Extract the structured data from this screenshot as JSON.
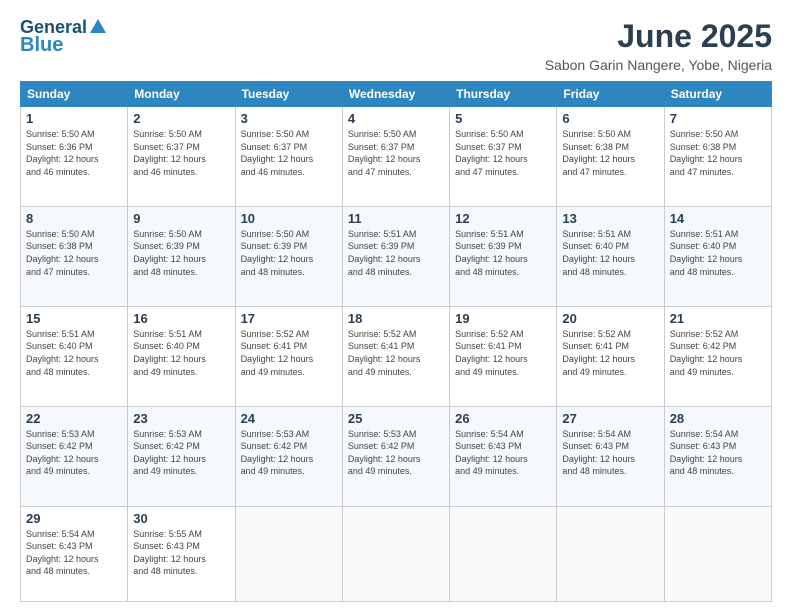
{
  "header": {
    "logo_line1": "General",
    "logo_line2": "Blue",
    "month_title": "June 2025",
    "subtitle": "Sabon Garin Nangere, Yobe, Nigeria"
  },
  "days_of_week": [
    "Sunday",
    "Monday",
    "Tuesday",
    "Wednesday",
    "Thursday",
    "Friday",
    "Saturday"
  ],
  "weeks": [
    [
      {
        "day": "1",
        "info": "Sunrise: 5:50 AM\nSunset: 6:36 PM\nDaylight: 12 hours\nand 46 minutes."
      },
      {
        "day": "2",
        "info": "Sunrise: 5:50 AM\nSunset: 6:37 PM\nDaylight: 12 hours\nand 46 minutes."
      },
      {
        "day": "3",
        "info": "Sunrise: 5:50 AM\nSunset: 6:37 PM\nDaylight: 12 hours\nand 46 minutes."
      },
      {
        "day": "4",
        "info": "Sunrise: 5:50 AM\nSunset: 6:37 PM\nDaylight: 12 hours\nand 47 minutes."
      },
      {
        "day": "5",
        "info": "Sunrise: 5:50 AM\nSunset: 6:37 PM\nDaylight: 12 hours\nand 47 minutes."
      },
      {
        "day": "6",
        "info": "Sunrise: 5:50 AM\nSunset: 6:38 PM\nDaylight: 12 hours\nand 47 minutes."
      },
      {
        "day": "7",
        "info": "Sunrise: 5:50 AM\nSunset: 6:38 PM\nDaylight: 12 hours\nand 47 minutes."
      }
    ],
    [
      {
        "day": "8",
        "info": "Sunrise: 5:50 AM\nSunset: 6:38 PM\nDaylight: 12 hours\nand 47 minutes."
      },
      {
        "day": "9",
        "info": "Sunrise: 5:50 AM\nSunset: 6:39 PM\nDaylight: 12 hours\nand 48 minutes."
      },
      {
        "day": "10",
        "info": "Sunrise: 5:50 AM\nSunset: 6:39 PM\nDaylight: 12 hours\nand 48 minutes."
      },
      {
        "day": "11",
        "info": "Sunrise: 5:51 AM\nSunset: 6:39 PM\nDaylight: 12 hours\nand 48 minutes."
      },
      {
        "day": "12",
        "info": "Sunrise: 5:51 AM\nSunset: 6:39 PM\nDaylight: 12 hours\nand 48 minutes."
      },
      {
        "day": "13",
        "info": "Sunrise: 5:51 AM\nSunset: 6:40 PM\nDaylight: 12 hours\nand 48 minutes."
      },
      {
        "day": "14",
        "info": "Sunrise: 5:51 AM\nSunset: 6:40 PM\nDaylight: 12 hours\nand 48 minutes."
      }
    ],
    [
      {
        "day": "15",
        "info": "Sunrise: 5:51 AM\nSunset: 6:40 PM\nDaylight: 12 hours\nand 48 minutes."
      },
      {
        "day": "16",
        "info": "Sunrise: 5:51 AM\nSunset: 6:40 PM\nDaylight: 12 hours\nand 49 minutes."
      },
      {
        "day": "17",
        "info": "Sunrise: 5:52 AM\nSunset: 6:41 PM\nDaylight: 12 hours\nand 49 minutes."
      },
      {
        "day": "18",
        "info": "Sunrise: 5:52 AM\nSunset: 6:41 PM\nDaylight: 12 hours\nand 49 minutes."
      },
      {
        "day": "19",
        "info": "Sunrise: 5:52 AM\nSunset: 6:41 PM\nDaylight: 12 hours\nand 49 minutes."
      },
      {
        "day": "20",
        "info": "Sunrise: 5:52 AM\nSunset: 6:41 PM\nDaylight: 12 hours\nand 49 minutes."
      },
      {
        "day": "21",
        "info": "Sunrise: 5:52 AM\nSunset: 6:42 PM\nDaylight: 12 hours\nand 49 minutes."
      }
    ],
    [
      {
        "day": "22",
        "info": "Sunrise: 5:53 AM\nSunset: 6:42 PM\nDaylight: 12 hours\nand 49 minutes."
      },
      {
        "day": "23",
        "info": "Sunrise: 5:53 AM\nSunset: 6:42 PM\nDaylight: 12 hours\nand 49 minutes."
      },
      {
        "day": "24",
        "info": "Sunrise: 5:53 AM\nSunset: 6:42 PM\nDaylight: 12 hours\nand 49 minutes."
      },
      {
        "day": "25",
        "info": "Sunrise: 5:53 AM\nSunset: 6:42 PM\nDaylight: 12 hours\nand 49 minutes."
      },
      {
        "day": "26",
        "info": "Sunrise: 5:54 AM\nSunset: 6:43 PM\nDaylight: 12 hours\nand 49 minutes."
      },
      {
        "day": "27",
        "info": "Sunrise: 5:54 AM\nSunset: 6:43 PM\nDaylight: 12 hours\nand 48 minutes."
      },
      {
        "day": "28",
        "info": "Sunrise: 5:54 AM\nSunset: 6:43 PM\nDaylight: 12 hours\nand 48 minutes."
      }
    ],
    [
      {
        "day": "29",
        "info": "Sunrise: 5:54 AM\nSunset: 6:43 PM\nDaylight: 12 hours\nand 48 minutes."
      },
      {
        "day": "30",
        "info": "Sunrise: 5:55 AM\nSunset: 6:43 PM\nDaylight: 12 hours\nand 48 minutes."
      },
      {
        "day": "",
        "info": ""
      },
      {
        "day": "",
        "info": ""
      },
      {
        "day": "",
        "info": ""
      },
      {
        "day": "",
        "info": ""
      },
      {
        "day": "",
        "info": ""
      }
    ]
  ]
}
